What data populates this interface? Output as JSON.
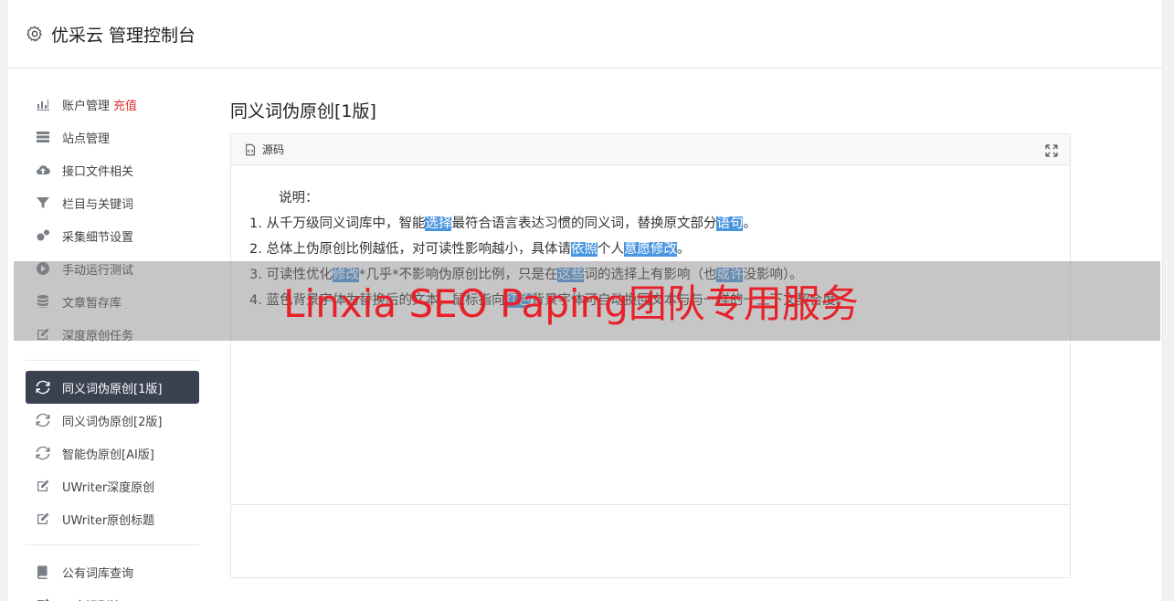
{
  "header": {
    "title": "优采云 管理控制台",
    "icon": "gear-icon"
  },
  "sidebar": {
    "group1": [
      {
        "label": "账户管理",
        "badge": "充值",
        "icon": "bar-chart-icon"
      },
      {
        "label": "站点管理",
        "icon": "server-icon"
      },
      {
        "label": "接口文件相关",
        "icon": "cloud-upload-icon"
      },
      {
        "label": "栏目与关键词",
        "icon": "filter-icon"
      },
      {
        "label": "采集细节设置",
        "icon": "cogs-icon"
      },
      {
        "label": "手动运行测试",
        "icon": "play-circle-icon"
      },
      {
        "label": "文章暂存库",
        "icon": "database-icon"
      },
      {
        "label": "深度原创任务",
        "icon": "edit-icon"
      }
    ],
    "group2": [
      {
        "label": "同义词伪原创[1版]",
        "icon": "refresh-icon",
        "active": true
      },
      {
        "label": "同义词伪原创[2版]",
        "icon": "refresh-icon"
      },
      {
        "label": "智能伪原创[AI版]",
        "icon": "refresh-icon"
      },
      {
        "label": "UWriter深度原创",
        "icon": "edit-icon"
      },
      {
        "label": "UWriter原创标题",
        "icon": "edit-icon"
      }
    ],
    "group3": [
      {
        "label": "公有词库查询",
        "icon": "book-icon"
      },
      {
        "label": "正文识别演示",
        "icon": "edit-icon"
      }
    ]
  },
  "main": {
    "title": "同义词伪原创[1版]",
    "panel": {
      "tab_label": "源码",
      "icon": "source-code-icon",
      "expand_icon": "expand-icon"
    },
    "editor": {
      "intro": "说明：",
      "lines": [
        [
          {
            "t": "1. 从千万级同义词库中，智能"
          },
          {
            "t": "选择",
            "hl": true
          },
          {
            "t": "最符合语言表达习惯的同义词，替换原文部分"
          },
          {
            "t": "语句",
            "hl": true
          },
          {
            "t": "。"
          }
        ],
        [
          {
            "t": "2. 总体上伪原创比例越低，对可读性影响越小，具体请"
          },
          {
            "t": "依照",
            "hl": true
          },
          {
            "t": "个人"
          },
          {
            "t": "意愿",
            "hl": true
          },
          {
            "t": "修改",
            "hl": true
          },
          {
            "t": "。"
          }
        ],
        [
          {
            "t": "3. 可读性优化"
          },
          {
            "t": "修改",
            "hl": true
          },
          {
            "t": "*几乎*不影响伪原创比例，只是在"
          },
          {
            "t": "这些",
            "hl": true
          },
          {
            "t": "词的选择上有影响（也"
          },
          {
            "t": "或许",
            "hl": true
          },
          {
            "t": "没影响）。"
          }
        ],
        [
          {
            "t": "4. 蓝色背景字体为替换后的文本，鼠标指向"
          },
          {
            "t": "红色",
            "hl": true
          },
          {
            "t": "背景字体可自动换回文本与与一样的一上下文契合度。"
          }
        ]
      ]
    }
  },
  "watermark": {
    "text": "Linxia SEO Paping团队专用服务"
  },
  "colors": {
    "accent": "#4a95e0",
    "active_bg": "#3a4252",
    "charge": "#e03030",
    "watermark": "#e8202a"
  }
}
